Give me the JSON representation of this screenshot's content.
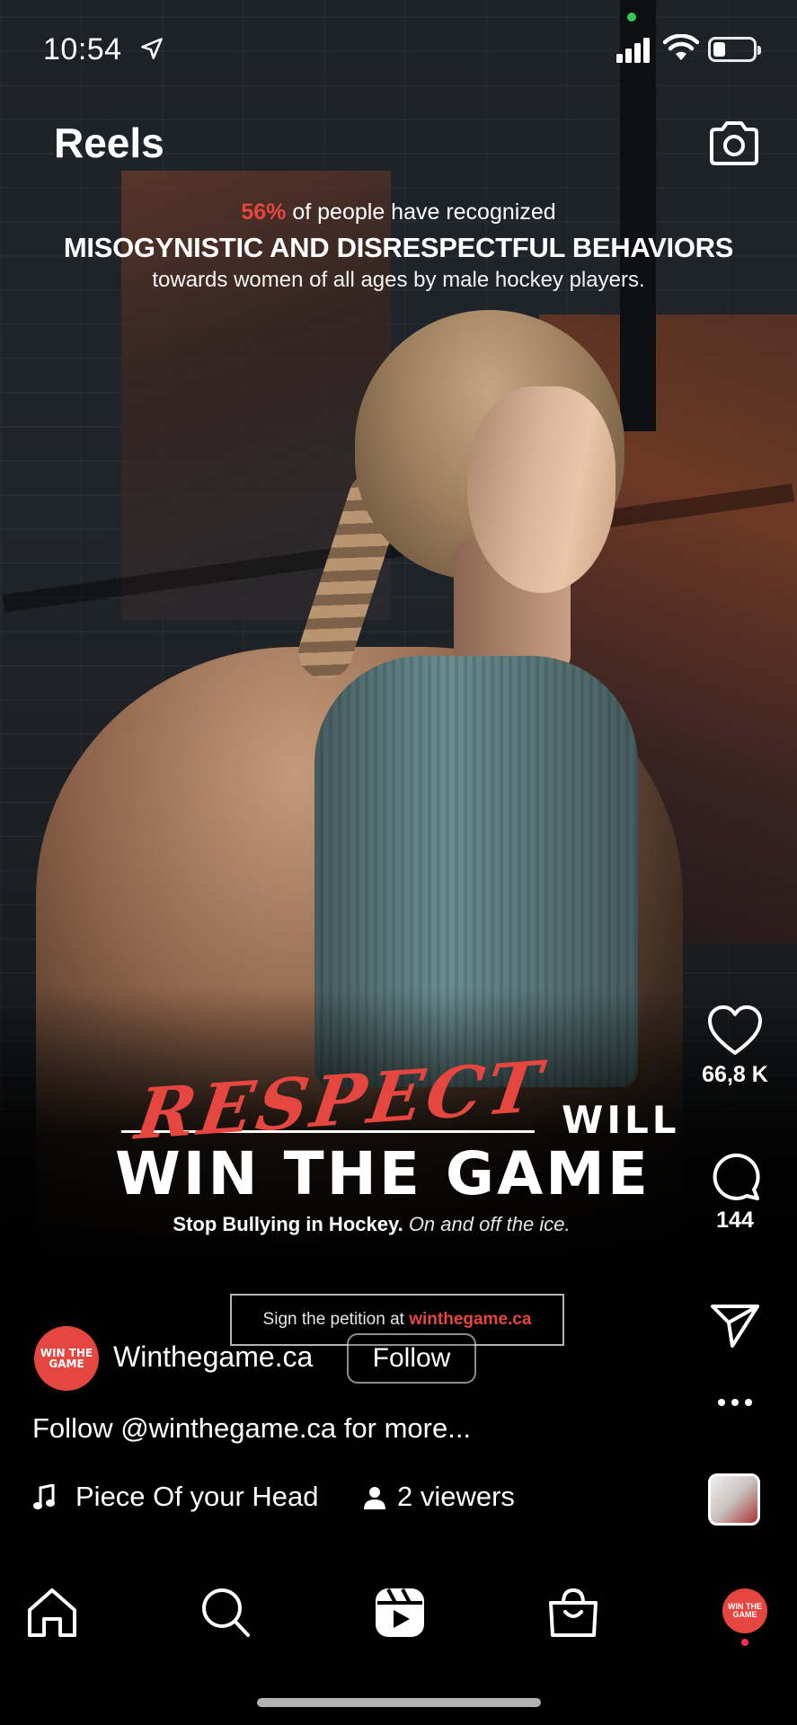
{
  "status_bar": {
    "time": "10:54",
    "battery_level": 0.3
  },
  "header": {
    "title": "Reels"
  },
  "overlay": {
    "stat_percent": "56%",
    "stat_text": " of people have recognized",
    "headline": "MISOGYNISTIC AND DISRESPECTFUL BEHAVIORS",
    "subline": "towards women of all ages by male hockey players.",
    "logo_respect": "RESPECT",
    "logo_will": "WILL",
    "logo_win": "WIN THE GAME",
    "tagline_bold": "Stop Bullying in Hockey.",
    "tagline_italic": "On and off the ice.",
    "petition_prefix": "Sign the petition at ",
    "petition_url": "winthegame.ca"
  },
  "actions": {
    "likes": "66,8 K",
    "comments": "144"
  },
  "post": {
    "avatar_text": "WIN THE GAME",
    "author": "Winthegame.ca",
    "follow_label": "Follow",
    "caption": "Follow @winthegame.ca for more...",
    "song": "Piece Of your Head",
    "viewers": "2 viewers"
  },
  "icons": {
    "location": "location-arrow-icon",
    "signal": "cellular-signal-icon",
    "wifi": "wifi-icon",
    "battery": "battery-icon",
    "camera": "camera-icon",
    "like": "heart-icon",
    "comment": "comment-icon",
    "share": "send-icon",
    "more": "more-icon",
    "music": "music-note-icon",
    "viewers": "person-icon",
    "home": "home-icon",
    "search": "search-icon",
    "reels": "reels-icon",
    "shop": "shop-icon"
  },
  "colors": {
    "accent_red": "#e5463f",
    "status_green": "#35c759"
  }
}
